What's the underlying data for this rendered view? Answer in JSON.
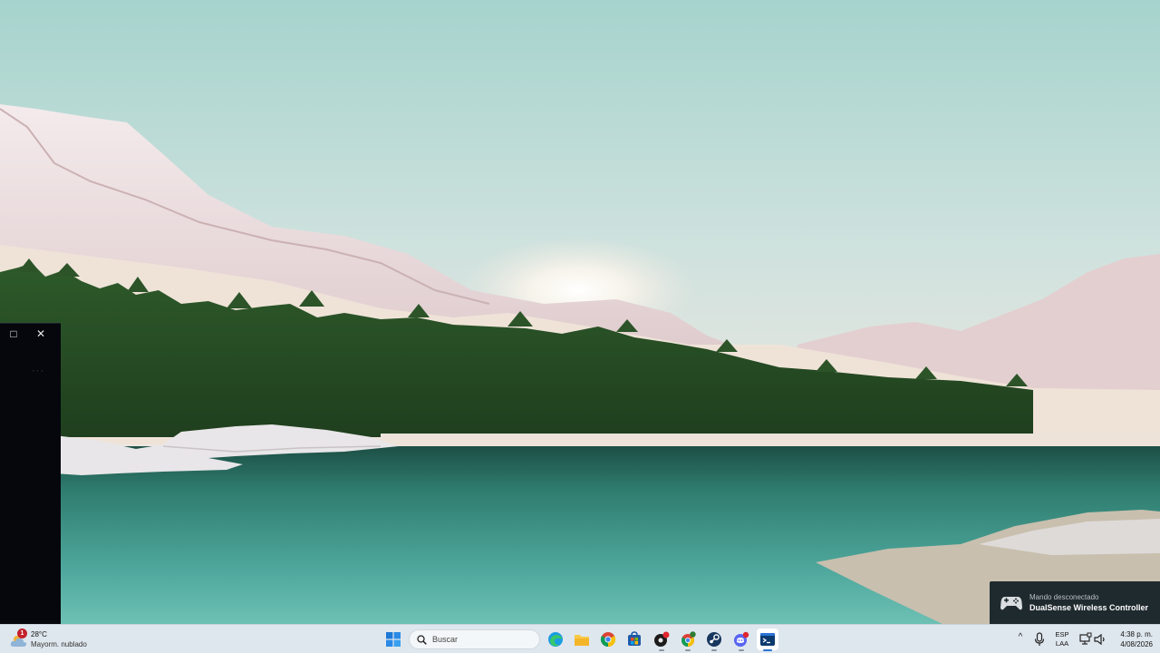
{
  "mini_window": {
    "maximize_icon": "□",
    "close_icon": "✕",
    "more_label": "···"
  },
  "toast": {
    "title": "Mando desconectado",
    "message": "DualSense Wireless Controller",
    "icon": "gamepad-icon"
  },
  "taskbar": {
    "weather": {
      "badge": "1",
      "temperature": "28°C",
      "condition": "Mayorm. nublado",
      "icon": "partly-cloudy-icon"
    },
    "search": {
      "label": "Buscar",
      "icon": "search-icon"
    },
    "apps": [
      {
        "name": "edge",
        "icon": "edge-icon"
      },
      {
        "name": "file-explorer",
        "icon": "folder-icon"
      },
      {
        "name": "chrome",
        "icon": "chrome-icon"
      },
      {
        "name": "store",
        "icon": "store-icon"
      },
      {
        "name": "app-black",
        "icon": "dark-app-icon"
      },
      {
        "name": "chrome-profile",
        "icon": "chrome-icon"
      },
      {
        "name": "steam",
        "icon": "steam-icon"
      },
      {
        "name": "discord",
        "icon": "discord-icon"
      },
      {
        "name": "terminal",
        "icon": "terminal-icon"
      }
    ],
    "tray": {
      "chevron": "^",
      "language_line1": "ESP",
      "language_line2": "LAA",
      "time": "4:38 p. m.",
      "date": "4/08/2026"
    }
  },
  "colors": {
    "taskbar_bg": "#dfe7ee",
    "toast_bg": "#1f2a2f",
    "accent": "#2b73d3"
  }
}
